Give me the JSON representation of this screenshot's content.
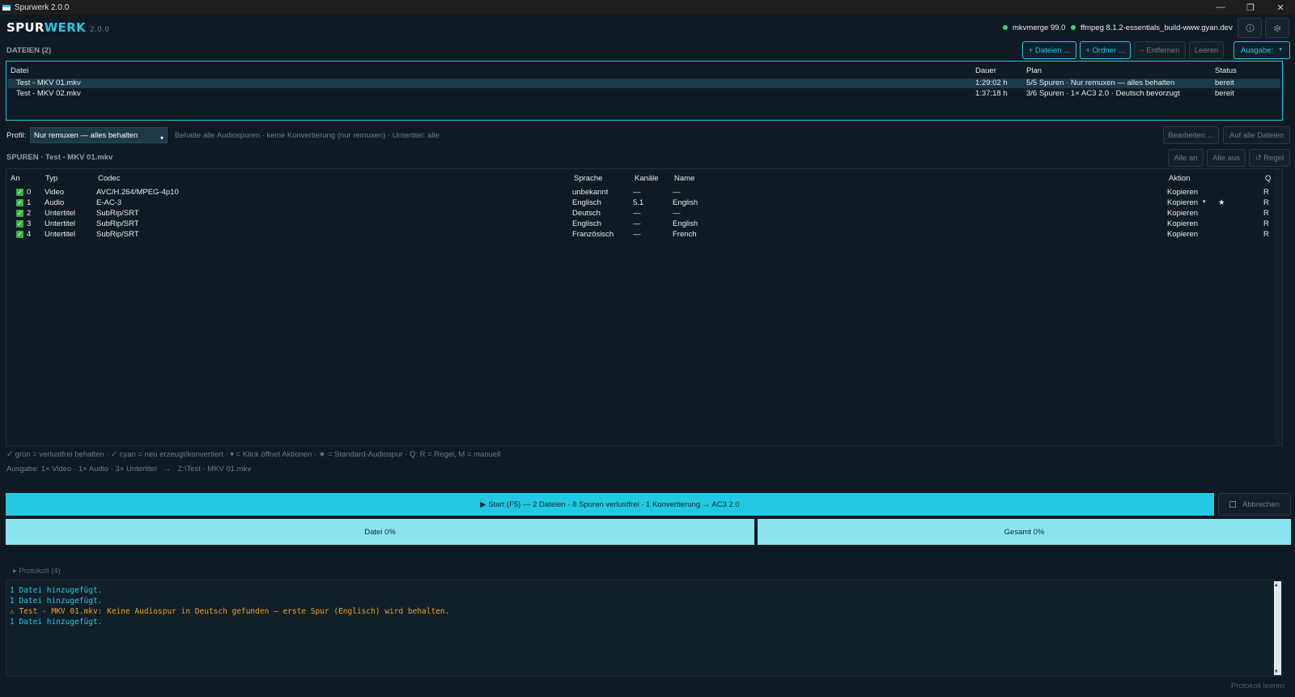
{
  "window": {
    "title": "Spurwerk 2.0.0",
    "controls": [
      "—",
      "❐",
      "✕"
    ]
  },
  "header": {
    "logo_part1": "SPUR",
    "logo_part2": "WERK",
    "version": "2.0.0",
    "tools": [
      {
        "label": "mkvmerge 99.0",
        "status_color": "#37d36b"
      },
      {
        "label": "ffmpeg 8.1.2-essentials_build-www.gyan.dev",
        "status_color": "#37d36b"
      }
    ],
    "icon_buttons": [
      "info-icon",
      "gear-icon"
    ]
  },
  "files_section": {
    "title": "DATEIEN (2)",
    "buttons": {
      "add_files": "+ Dateien ...",
      "add_folder": "+ Ordner ...",
      "remove": "– Entfernen",
      "clear": "Leeren",
      "output": "Ausgabe:"
    },
    "columns": {
      "file": "Datei",
      "duration": "Dauer",
      "plan": "Plan",
      "status": "Status"
    },
    "rows": [
      {
        "file": "Test - MKV 01.mkv",
        "duration": "1:29:02 h",
        "plan": "5/5 Spuren · Nur remuxen — alles behalten",
        "status": "bereit",
        "selected": true
      },
      {
        "file": "Test - MKV 02.mkv",
        "duration": "1:37:18 h",
        "plan": "3/6 Spuren · 1× AC3 2.0 · Deutsch bevorzugt",
        "status": "bereit",
        "selected": false
      }
    ]
  },
  "profile": {
    "label": "Profil:",
    "selected": "Nur remuxen — alles behalten",
    "description": "Behalte alle Audiospuren · keine Konvertierung (nur remuxen) · Untertitel: alle",
    "edit_button": "Bearbeiten ...",
    "apply_all_button": "Auf alle Dateien"
  },
  "tracks_section": {
    "title": "SPUREN · Test - MKV 01.mkv",
    "buttons": {
      "all_on": "Alle an",
      "all_off": "Alle aus",
      "rule": "↺ Regel"
    },
    "columns": {
      "on": "An",
      "type": "Typ",
      "codec": "Codec",
      "language": "Sprache",
      "channels": "Kanäle",
      "name": "Name",
      "action": "Aktion",
      "q": "Q"
    },
    "rows": [
      {
        "index": "0",
        "type": "Video",
        "codec": "AVC/H.264/MPEG-4p10",
        "language": "unbekannt",
        "channels": "—",
        "name": "—",
        "action": "Kopieren",
        "q": "R",
        "default_marker": ""
      },
      {
        "index": "1",
        "type": "Audio",
        "codec": "E-AC-3",
        "language": "Englisch",
        "channels": "5.1",
        "name": "English",
        "action": "Kopieren",
        "q": "R",
        "default_marker": "★"
      },
      {
        "index": "2",
        "type": "Untertitel",
        "codec": "SubRip/SRT",
        "language": "Deutsch",
        "channels": "—",
        "name": "—",
        "action": "Kopieren",
        "q": "R",
        "default_marker": ""
      },
      {
        "index": "3",
        "type": "Untertitel",
        "codec": "SubRip/SRT",
        "language": "Englisch",
        "channels": "—",
        "name": "English",
        "action": "Kopieren",
        "q": "R",
        "default_marker": ""
      },
      {
        "index": "4",
        "type": "Untertitel",
        "codec": "SubRip/SRT",
        "language": "Französisch",
        "channels": "—",
        "name": "French",
        "action": "Kopieren",
        "q": "R",
        "default_marker": ""
      }
    ]
  },
  "legend": "✓ grün = verlustfrei behalten · ✓ cyan = neu erzeugt/konvertiert · ▾ = Klick öffnet Aktionen · ★ = Standard-Audiospur · Q: R = Regel, M = manuell",
  "output_info": "Ausgabe: 1× Video · 1× Audio · 3× Untertitel   →   Z:\\Test - MKV 01.mkv",
  "run": {
    "start_label": "▶  Start (F5) — 2 Dateien · 8 Spuren verlustfrei · 1 Konvertierung → AC3 2.0",
    "cancel_label": "Abbrechen",
    "file_progress_label": "Datei  0%",
    "file_progress": 0,
    "total_progress_label": "Gesamt  0%",
    "total_progress": 0
  },
  "log": {
    "toggle_label": "▸  Protokoll (4)",
    "lines": [
      {
        "text": "1 Datei hinzugefügt.",
        "level": "info"
      },
      {
        "text": "1 Datei hinzugefügt.",
        "level": "info"
      },
      {
        "text": "⚠ Test - MKV 01.mkv: Keine Audiospur in Deutsch gefunden – erste Spur (Englisch) wird behalten.",
        "level": "warning"
      },
      {
        "text": "1 Datei hinzugefügt.",
        "level": "info"
      }
    ],
    "clear_label": "Protokoll leeren"
  },
  "colors": {
    "accent": "#22c9e3",
    "background": "#0f1a22",
    "selection": "#1d3a47",
    "ok_green": "#37b34a",
    "warning": "#f0a020",
    "info": "#22c9e3"
  }
}
